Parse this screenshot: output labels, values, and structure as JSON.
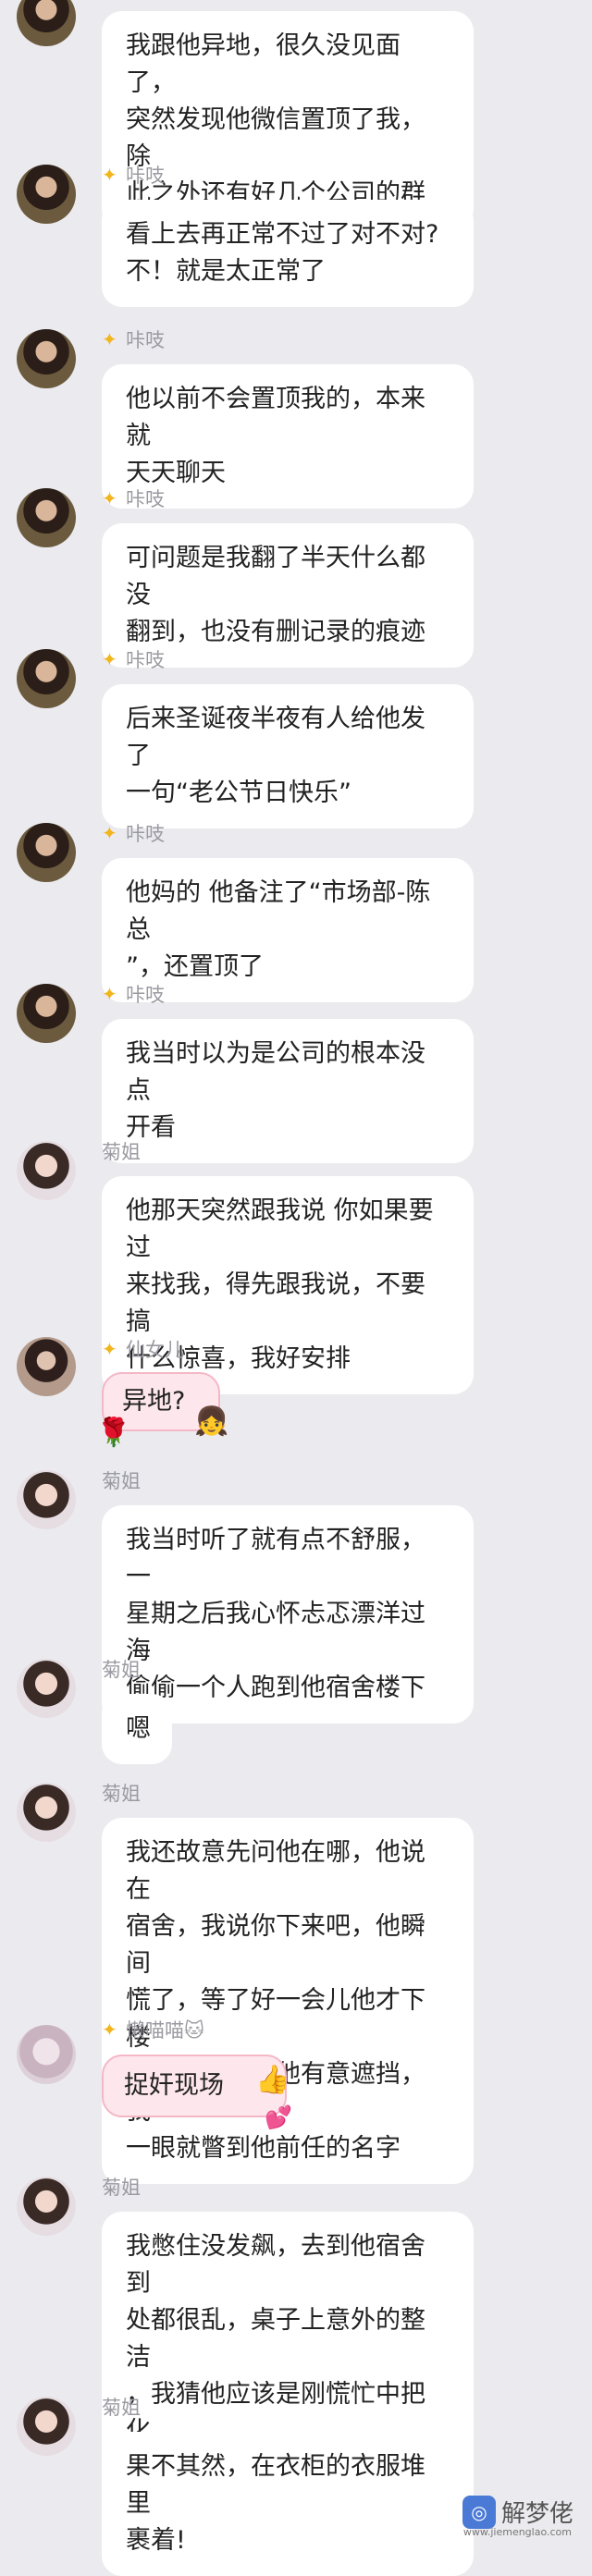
{
  "messages": [
    {
      "name": "",
      "avatar": "a",
      "text": "我跟他异地，很久没见面了，\n突然发现他微信置顶了我，除\n此之外还有好几个公司的群",
      "badge": false
    },
    {
      "name": "咔吱",
      "avatar": "a",
      "text": "看上去再正常不过了对不对?\n不！就是太正常了",
      "badge": true
    },
    {
      "name": "咔吱",
      "avatar": "a",
      "text": "他以前不会置顶我的，本来就\n天天聊天",
      "badge": true
    },
    {
      "name": "咔吱",
      "avatar": "a",
      "text": "可问题是我翻了半天什么都没\n翻到，也没有删记录的痕迹",
      "badge": true
    },
    {
      "name": "咔吱",
      "avatar": "a",
      "text": "后来圣诞夜半夜有人给他发了\n一句“老公节日快乐”",
      "badge": true
    },
    {
      "name": "咔吱",
      "avatar": "a",
      "text": "他妈的 他备注了“市场部-陈总\n”，还置顶了",
      "badge": true
    },
    {
      "name": "咔吱",
      "avatar": "a",
      "text": "我当时以为是公司的根本没点\n开看",
      "badge": true
    },
    {
      "name": "菊姐",
      "avatar": "b",
      "text": "他那天突然跟我说 你如果要过\n来找我，得先跟我说，不要搞\n什么惊喜，我好安排",
      "badge": false
    },
    {
      "name": "仙女儿",
      "avatar": "c",
      "text": "异地?",
      "badge": true
    },
    {
      "name": "菊姐",
      "avatar": "b",
      "text": "我当时听了就有点不舒服，一\n星期之后我心怀忐忑漂洋过海\n偷偷一个人跑到他宿舍楼下",
      "badge": false
    },
    {
      "name": "菊姐",
      "avatar": "b",
      "text": "嗯",
      "badge": false
    },
    {
      "name": "菊姐",
      "avatar": "b",
      "text": "我还故意先问他在哪，他说在\n宿舍，我说你下来吧，他瞬间\n慌了，等了好一会儿他才下楼\n，登记的时候他有意遮挡，我\n一眼就瞥到他前任的名字",
      "badge": false
    },
    {
      "name": "懒喵喵🐱",
      "avatar": "d",
      "text": "捉奸现场",
      "badge": true
    },
    {
      "name": "菊姐",
      "avatar": "b",
      "text": "我憋住没发飙，去到他宿舍到\n处都很乱，桌子上意外的整洁\n，我猜他应该是刚慌忙中把化\n妆品什么的藏起来了",
      "badge": false
    },
    {
      "name": "菊姐",
      "avatar": "b",
      "text": "果不其然，在衣柜的衣服堆里\n裹着!",
      "badge": false
    }
  ],
  "watermark": {
    "brand": "解梦佬",
    "url": "www.jiemenglao.com"
  }
}
